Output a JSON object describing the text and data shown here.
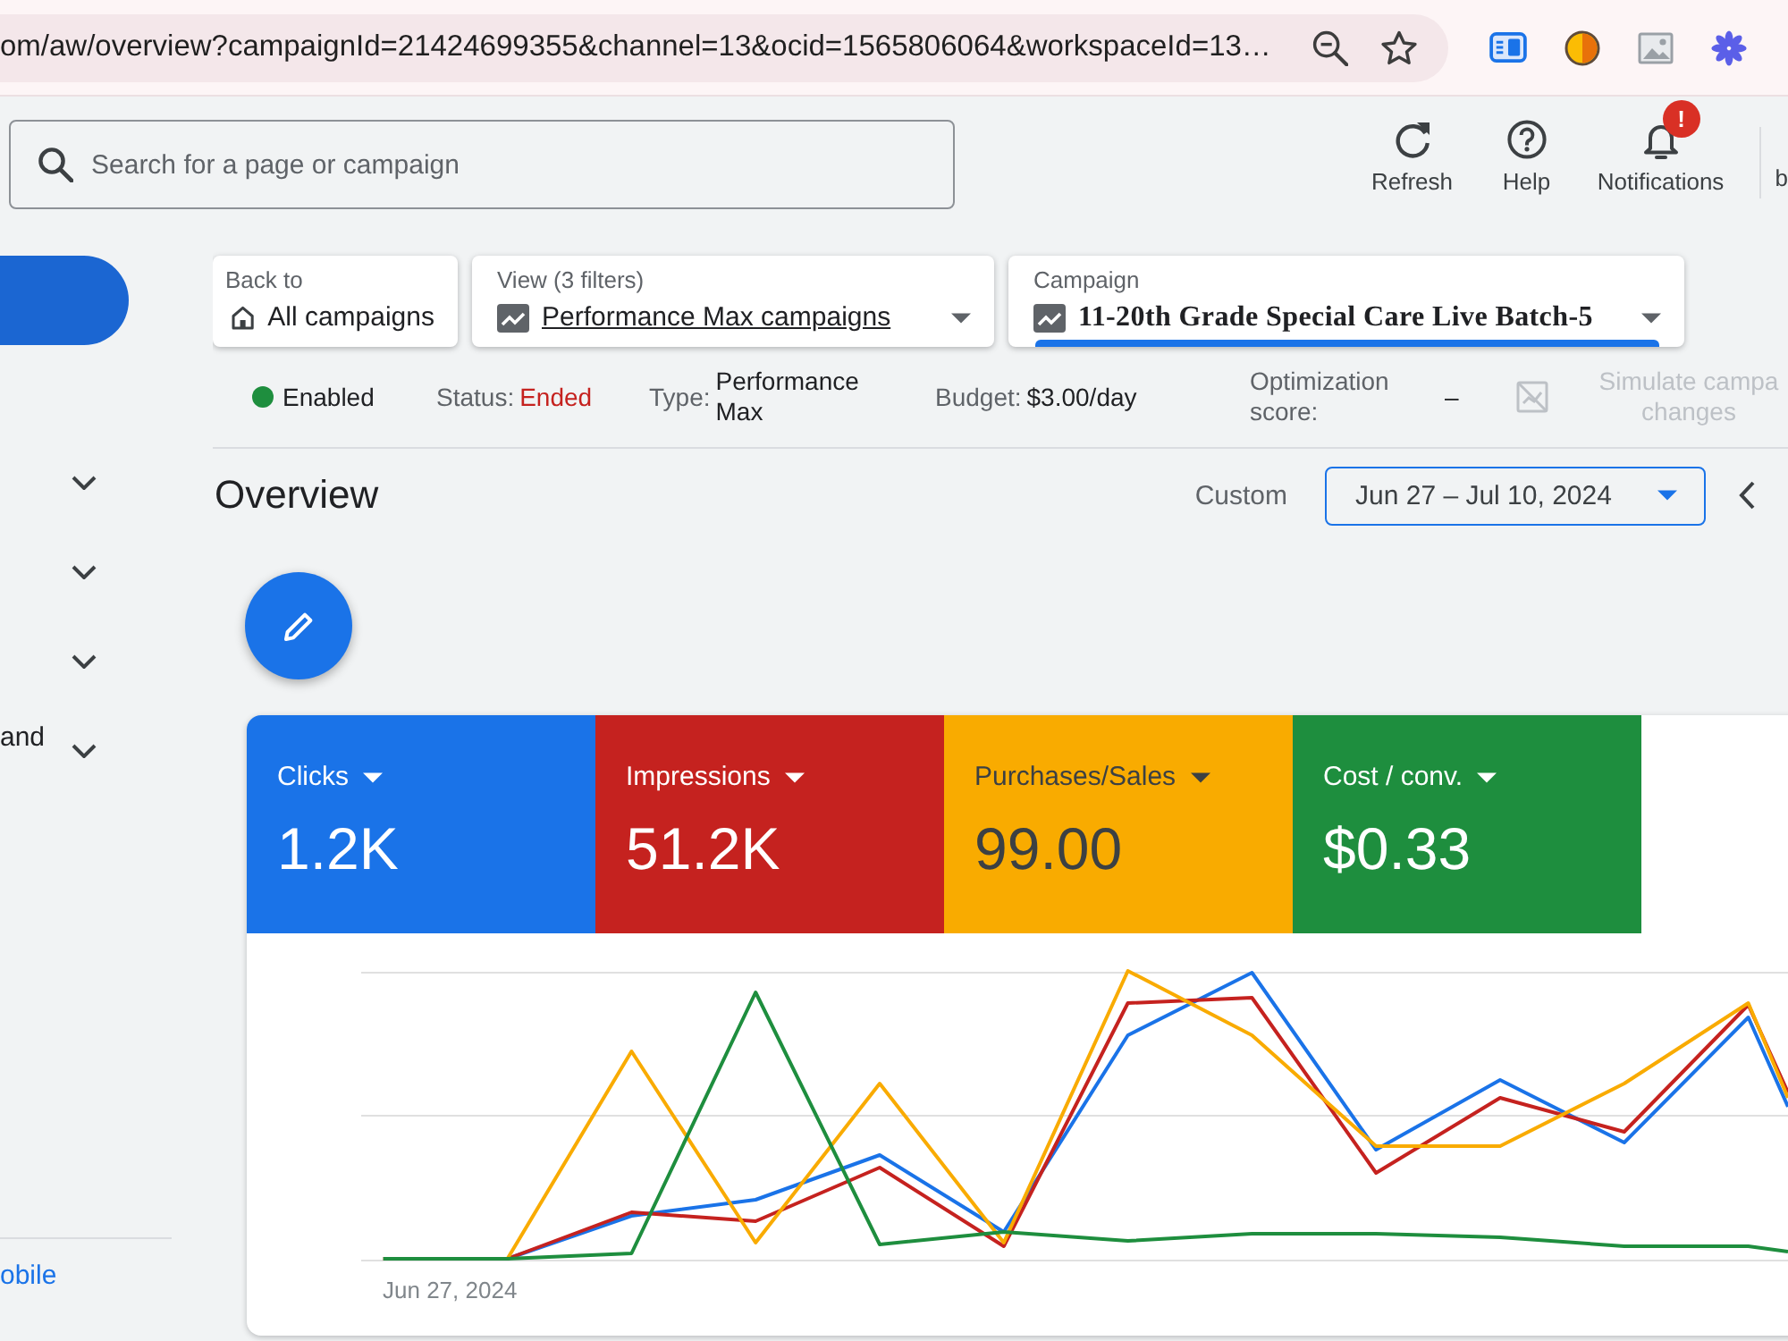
{
  "browser": {
    "url": "om/aw/overview?campaignId=21424699355&channel=13&ocid=1565806064&workspaceId=13…"
  },
  "header": {
    "search": {
      "placeholder": "Search for a page or campaign"
    },
    "actions": [
      {
        "kind": "refresh",
        "label": "Refresh"
      },
      {
        "kind": "help",
        "label": "Help"
      },
      {
        "kind": "notifications",
        "label": "Notifications",
        "badge": "!"
      }
    ],
    "cut_label": "b"
  },
  "sidebar": {
    "items": [
      {
        "expanded": false
      },
      {
        "expanded": false
      },
      {
        "expanded": false
      },
      {
        "label": "and",
        "expanded": false
      }
    ],
    "footer_link": "obile"
  },
  "filters": [
    {
      "kind": "back",
      "caption": "Back to",
      "value": "All campaigns"
    },
    {
      "kind": "view",
      "caption": "View (3 filters)",
      "value": "Performance Max campaigns"
    },
    {
      "kind": "campaign",
      "caption": "Campaign",
      "value": "11-20th Grade Special Care Live Batch-5"
    }
  ],
  "summary": {
    "state": {
      "label": "Enabled",
      "color": "#1e8e3e"
    },
    "fields": [
      {
        "kind": "alert",
        "label": "Status:",
        "value": "Ended"
      },
      {
        "kind": "plain",
        "label": "Type:",
        "value": "Performance Max"
      },
      {
        "kind": "plain",
        "label": "Budget:",
        "value": "$3.00/day"
      },
      {
        "kind": "plain",
        "label": "Optimization score:",
        "value": "–"
      }
    ],
    "simulate": {
      "label": "Simulate campa changes",
      "disabled": true
    }
  },
  "overview": {
    "title": "Overview",
    "range_label": "Custom",
    "date_range": "Jun 27 – Jul 10, 2024"
  },
  "metrics": [
    {
      "label": "Clicks",
      "value": "1.2K",
      "color": "#1a73e8"
    },
    {
      "label": "Impressions",
      "value": "51.2K",
      "color": "#c5221f"
    },
    {
      "label": "Purchases/Sales",
      "value": "99.00",
      "color": "#f9ab00"
    },
    {
      "label": "Cost / conv.",
      "value": "$0.33",
      "color": "#1e8e3e"
    }
  ],
  "chart": {
    "start_label": "Jun 27, 2024"
  }
}
